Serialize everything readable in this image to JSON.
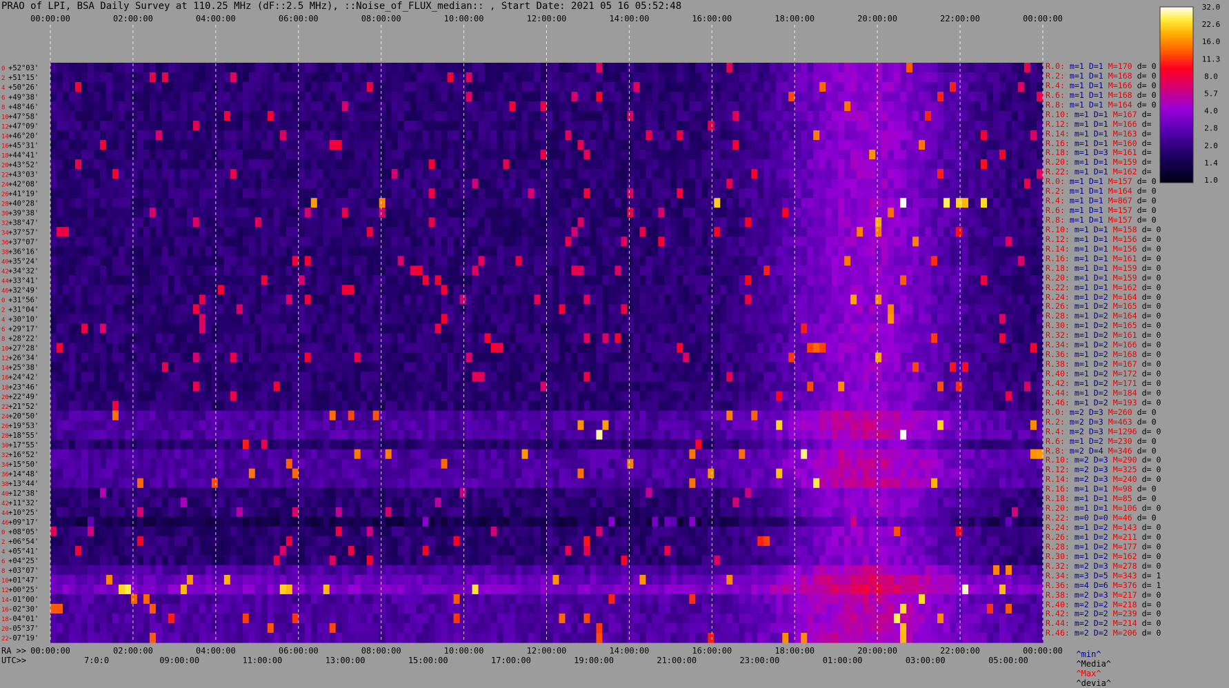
{
  "title": "PRAO of LPI, BSA Daily Survey at 110.25 MHz (dF::2.5 MHz), ::Noise_of_FLUX_median:: , Start Date: 2021 05 16 05:52:48",
  "axis_prefix": {
    "ra": "RA >>",
    "utc": "UTC>>"
  },
  "footer_legend": {
    "min": "^min^",
    "media": "^Media^",
    "max": "^Max^",
    "devia": "^devia^"
  },
  "colors": {
    "background": "#9c9c9c",
    "title": "#000000",
    "row_name": "#ee0000",
    "grid": "#ffffff"
  },
  "chart_data": {
    "type": "heatmap",
    "title": "PRAO of LPI, BSA Daily Survey at 110.25 MHz (dF::2.5 MHz), ::Noise_of_FLUX_median:: , Start Date: 2021 05 16 05:52:48",
    "x_top_ticks": [
      "00:00:00",
      "02:00:00",
      "04:00:00",
      "06:00:00",
      "08:00:00",
      "10:00:00",
      "12:00:00",
      "14:00:00",
      "16:00:00",
      "18:00:00",
      "20:00:00",
      "22:00:00",
      "00:00:00"
    ],
    "x_ra_ticks": [
      "00:00:00",
      "02:00:00",
      "04:00:00",
      "06:00:00",
      "08:00:00",
      "10:00:00",
      "12:00:00",
      "14:00:00",
      "16:00:00",
      "18:00:00",
      "20:00:00",
      "22:00:00",
      "00:00:00"
    ],
    "x_utc_ticks": [
      "7:0:0",
      "09:00:00",
      "11:00:00",
      "13:00:00",
      "15:00:00",
      "17:00:00",
      "19:00:00",
      "21:00:00",
      "23:00:00",
      "01:00:00",
      "03:00:00",
      "05:00:00"
    ],
    "row_indices": [
      "0",
      "2",
      "4",
      "6",
      "8",
      "10",
      "12",
      "14",
      "16",
      "18",
      "20",
      "22",
      "24",
      "26",
      "28",
      "30",
      "32",
      "34",
      "36",
      "38",
      "40",
      "42",
      "44",
      "46",
      "0",
      "2",
      "4",
      "6",
      "8",
      "10",
      "12",
      "14",
      "16",
      "18",
      "20",
      "22",
      "24",
      "26",
      "28",
      "30",
      "32",
      "34",
      "36",
      "38",
      "40",
      "42",
      "44",
      "46",
      "0",
      "2",
      "4",
      "6",
      "8",
      "10",
      "12",
      "14",
      "16",
      "18",
      "20",
      "22",
      "24",
      "26",
      "28",
      "30",
      "32",
      "34",
      "36",
      "38",
      "40",
      "42",
      "44",
      "46"
    ],
    "y_declinations": [
      "+52°03'",
      "+51°15'",
      "+50°26'",
      "+49°38'",
      "+48°46'",
      "+47°58'",
      "+47°09'",
      "+46°20'",
      "+45°31'",
      "+44°41'",
      "+43°52'",
      "+43°03'",
      "+42°08'",
      "+41°19'",
      "+40°28'",
      "+39°38'",
      "+38°47'",
      "+37°57'",
      "+37°07'",
      "+36°16'",
      "+35°24'",
      "+34°32'",
      "+33°41'",
      "+32°49'",
      "+31°56'",
      "+31°04'",
      "+30°10'",
      "+29°17'",
      "+28°22'",
      "+27°28'",
      "+26°34'",
      "+25°38'",
      "+24°42'",
      "+23°46'",
      "+22°49'",
      "+21°52'",
      "+20°50'",
      "+19°53'",
      "+18°55'",
      "+17°55'",
      "+16°52'",
      "+15°50'",
      "+14°48'",
      "+13°44'",
      "+12°38'",
      "+11°32'",
      "+10°25'",
      "+09°17'",
      "+08°05'",
      "+06°54'",
      "+05°41'",
      "+04°25'",
      "+03°07'",
      "+01°47'",
      "+00°25'",
      "-01°00'",
      "-02°30'",
      "-04°01'",
      "-05°37'",
      "-07°19'"
    ],
    "row_stats": [
      {
        "name": "R.0:",
        "m": 1,
        "d": 1,
        "M": 170,
        "dev": 0
      },
      {
        "name": "R.2:",
        "m": 1,
        "d": 1,
        "M": 168,
        "dev": 0
      },
      {
        "name": "R.4:",
        "m": 1,
        "d": 1,
        "M": 166,
        "dev": 0
      },
      {
        "name": "R.6:",
        "m": 1,
        "d": 1,
        "M": 168,
        "dev": 0
      },
      {
        "name": "R.8:",
        "m": 1,
        "d": 1,
        "M": 164,
        "dev": 0
      },
      {
        "name": "R.10:",
        "m": 1,
        "d": 1,
        "M": 167,
        "dev": ""
      },
      {
        "name": "R.12:",
        "m": 1,
        "d": 1,
        "M": 166,
        "dev": ""
      },
      {
        "name": "R.14:",
        "m": 1,
        "d": 1,
        "M": 163,
        "dev": ""
      },
      {
        "name": "R.16:",
        "m": 1,
        "d": 1,
        "M": 160,
        "dev": ""
      },
      {
        "name": "R.18:",
        "m": 1,
        "d": 3,
        "M": 161,
        "dev": ""
      },
      {
        "name": "R.20:",
        "m": 1,
        "d": 1,
        "M": 159,
        "dev": ""
      },
      {
        "name": "R.22:",
        "m": 1,
        "d": 1,
        "M": 162,
        "dev": ""
      },
      {
        "name": "R.0:",
        "m": 1,
        "d": 1,
        "M": 157,
        "dev": 0
      },
      {
        "name": "R.2:",
        "m": 1,
        "d": 1,
        "M": 164,
        "dev": 0
      },
      {
        "name": "R.4:",
        "m": 1,
        "d": 1,
        "M": 867,
        "dev": 0
      },
      {
        "name": "R.6:",
        "m": 1,
        "d": 1,
        "M": 157,
        "dev": 0
      },
      {
        "name": "R.8:",
        "m": 1,
        "d": 1,
        "M": 157,
        "dev": 0
      },
      {
        "name": "R.10:",
        "m": 1,
        "d": 1,
        "M": 158,
        "dev": 0
      },
      {
        "name": "R.12:",
        "m": 1,
        "d": 1,
        "M": 156,
        "dev": 0
      },
      {
        "name": "R.14:",
        "m": 1,
        "d": 1,
        "M": 156,
        "dev": 0
      },
      {
        "name": "R.16:",
        "m": 1,
        "d": 1,
        "M": 161,
        "dev": 0
      },
      {
        "name": "R.18:",
        "m": 1,
        "d": 1,
        "M": 159,
        "dev": 0
      },
      {
        "name": "R.20:",
        "m": 1,
        "d": 1,
        "M": 159,
        "dev": 0
      },
      {
        "name": "R.22:",
        "m": 1,
        "d": 1,
        "M": 162,
        "dev": 0
      },
      {
        "name": "R.24:",
        "m": 1,
        "d": 2,
        "M": 164,
        "dev": 0
      },
      {
        "name": "R.26:",
        "m": 1,
        "d": 2,
        "M": 165,
        "dev": 0
      },
      {
        "name": "R.28:",
        "m": 1,
        "d": 2,
        "M": 164,
        "dev": 0
      },
      {
        "name": "R.30:",
        "m": 1,
        "d": 2,
        "M": 165,
        "dev": 0
      },
      {
        "name": "R.32:",
        "m": 1,
        "d": 2,
        "M": 161,
        "dev": 0
      },
      {
        "name": "R.34:",
        "m": 1,
        "d": 2,
        "M": 166,
        "dev": 0
      },
      {
        "name": "R.36:",
        "m": 1,
        "d": 2,
        "M": 168,
        "dev": 0
      },
      {
        "name": "R.38:",
        "m": 1,
        "d": 2,
        "M": 167,
        "dev": 0
      },
      {
        "name": "R.40:",
        "m": 1,
        "d": 2,
        "M": 172,
        "dev": 0
      },
      {
        "name": "R.42:",
        "m": 1,
        "d": 2,
        "M": 171,
        "dev": 0
      },
      {
        "name": "R.44:",
        "m": 1,
        "d": 2,
        "M": 184,
        "dev": 0
      },
      {
        "name": "R.46:",
        "m": 1,
        "d": 2,
        "M": 193,
        "dev": 0
      },
      {
        "name": "R.0:",
        "m": 2,
        "d": 3,
        "M": 260,
        "dev": 0
      },
      {
        "name": "R.2:",
        "m": 2,
        "d": 3,
        "M": 463,
        "dev": 0
      },
      {
        "name": "R.4:",
        "m": 2,
        "d": 3,
        "M": 1296,
        "dev": 0
      },
      {
        "name": "R.6:",
        "m": 1,
        "d": 2,
        "M": 230,
        "dev": 0
      },
      {
        "name": "R.8:",
        "m": 2,
        "d": 4,
        "M": 346,
        "dev": 0
      },
      {
        "name": "R.10:",
        "m": 2,
        "d": 3,
        "M": 290,
        "dev": 0
      },
      {
        "name": "R.12:",
        "m": 2,
        "d": 3,
        "M": 325,
        "dev": 0
      },
      {
        "name": "R.14:",
        "m": 2,
        "d": 3,
        "M": 240,
        "dev": 0
      },
      {
        "name": "R.16:",
        "m": 1,
        "d": 1,
        "M": 98,
        "dev": 0
      },
      {
        "name": "R.18:",
        "m": 1,
        "d": 1,
        "M": 85,
        "dev": 0
      },
      {
        "name": "R.20:",
        "m": 1,
        "d": 1,
        "M": 106,
        "dev": 0
      },
      {
        "name": "R.22:",
        "m": 0,
        "d": 0,
        "M": 46,
        "dev": 0
      },
      {
        "name": "R.24:",
        "m": 1,
        "d": 2,
        "M": 143,
        "dev": 0
      },
      {
        "name": "R.26:",
        "m": 1,
        "d": 2,
        "M": 211,
        "dev": 0
      },
      {
        "name": "R.28:",
        "m": 1,
        "d": 2,
        "M": 177,
        "dev": 0
      },
      {
        "name": "R.30:",
        "m": 1,
        "d": 2,
        "M": 162,
        "dev": 0
      },
      {
        "name": "R.32:",
        "m": 2,
        "d": 3,
        "M": 278,
        "dev": 0
      },
      {
        "name": "R.34:",
        "m": 3,
        "d": 5,
        "M": 343,
        "dev": 1
      },
      {
        "name": "R.36:",
        "m": 4,
        "d": 6,
        "M": 376,
        "dev": 1
      },
      {
        "name": "R.38:",
        "m": 2,
        "d": 3,
        "M": 217,
        "dev": 0
      },
      {
        "name": "R.40:",
        "m": 2,
        "d": 2,
        "M": 218,
        "dev": 0
      },
      {
        "name": "R.42:",
        "m": 2,
        "d": 2,
        "M": 239,
        "dev": 0
      },
      {
        "name": "R.44:",
        "m": 2,
        "d": 2,
        "M": 214,
        "dev": 0
      },
      {
        "name": "R.46:",
        "m": 2,
        "d": 2,
        "M": 206,
        "dev": 0
      }
    ],
    "colorbar_ticks": [
      "32.0",
      "22.6",
      "16.0",
      "11.3",
      "8.0",
      "5.7",
      "4.0",
      "2.8",
      "2.0",
      "1.4",
      "1.0"
    ],
    "colorbar_values": [
      32.0,
      22.6,
      16.0,
      11.3,
      8.0,
      5.7,
      4.0,
      2.8,
      2.0,
      1.4,
      1.0
    ],
    "color_scale": "log",
    "grid": true
  }
}
